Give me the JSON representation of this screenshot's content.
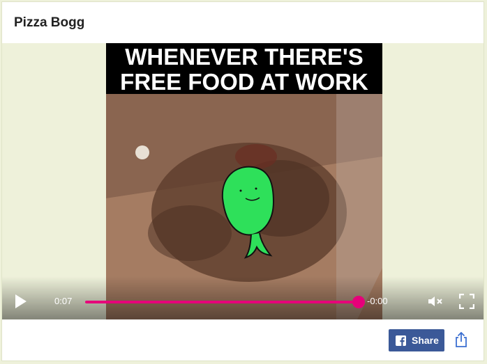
{
  "header": {
    "title": "Pizza Bogg"
  },
  "video": {
    "caption_line1": "WHENEVER THERE'S",
    "caption_line2": "FREE FOOD AT WORK",
    "current_time": "0:07",
    "remaining_time": "-0:00",
    "progress": 1.0,
    "accent_color": "#e6007a"
  },
  "footer": {
    "share_label": "Share",
    "share_icon": "facebook-icon",
    "share_color": "#3b5998",
    "upload_icon": "share-upload-icon"
  }
}
